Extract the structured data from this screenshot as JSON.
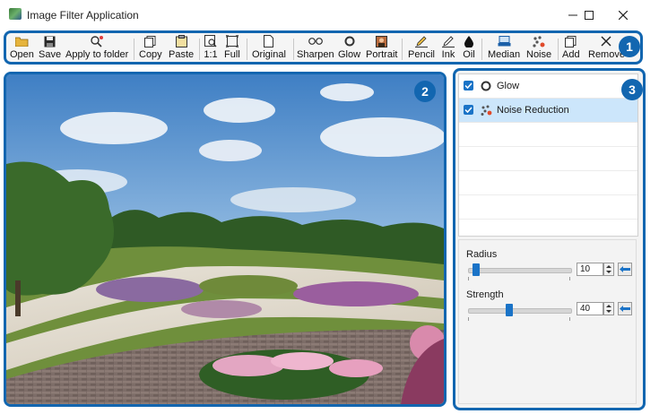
{
  "window": {
    "title": "Image Filter Application"
  },
  "toolbar": {
    "open": "Open",
    "save": "Save",
    "apply_to_folder": "Apply to folder",
    "copy": "Copy",
    "paste": "Paste",
    "zoom_1to1": "1:1",
    "full": "Full",
    "original": "Original",
    "sharpen": "Sharpen",
    "glow": "Glow",
    "portrait": "Portrait",
    "pencil": "Pencil",
    "ink": "Ink",
    "oil": "Oil",
    "median": "Median",
    "noise": "Noise",
    "add": "Add",
    "remove": "Remove"
  },
  "badges": {
    "toolbar": "1",
    "image": "2",
    "panel": "3"
  },
  "filters": [
    {
      "label": "Glow",
      "checked": true,
      "icon": "glow-icon"
    },
    {
      "label": "Noise Reduction",
      "checked": true,
      "icon": "noise-icon"
    }
  ],
  "params": {
    "radius": {
      "label": "Radius",
      "value": "10",
      "level": 0.05
    },
    "strength": {
      "label": "Strength",
      "value": "40",
      "level": 0.4
    }
  },
  "colors": {
    "accent": "#1266b0",
    "selection": "#cce6fb",
    "thumb": "#1a73c7"
  }
}
